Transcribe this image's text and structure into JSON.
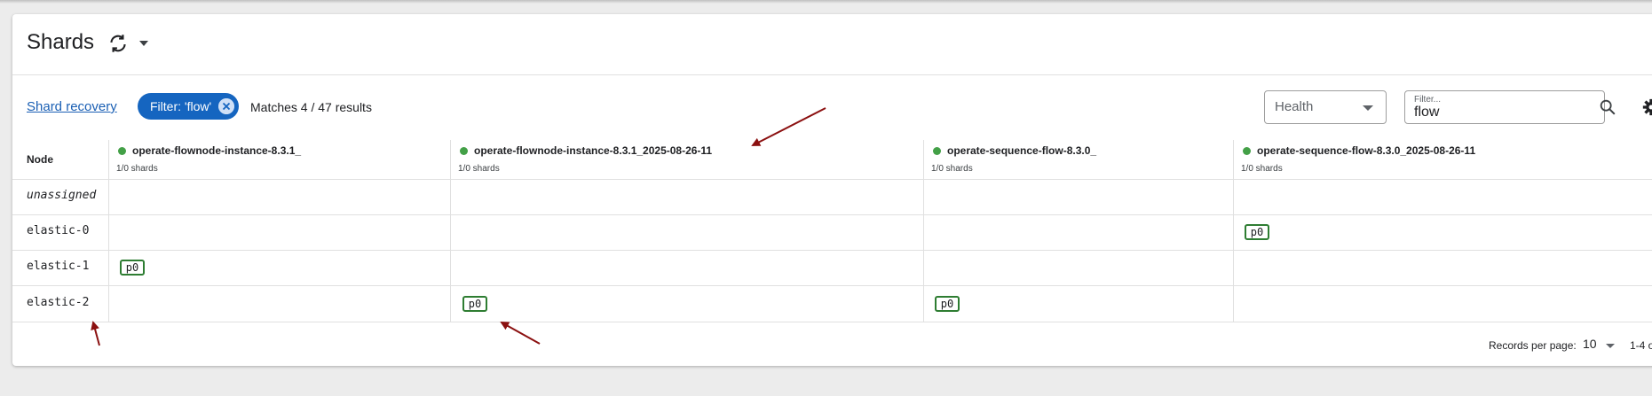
{
  "header": {
    "title": "Shards"
  },
  "toolbar": {
    "recovery_link": "Shard recovery",
    "filter_chip": "Filter: 'flow'",
    "matches": "Matches 4 / 47 results",
    "health_label": "Health",
    "filter_label": "Filter...",
    "filter_value": "flow"
  },
  "table": {
    "node_header": "Node",
    "indices": [
      {
        "name": "operate-flownode-instance-8.3.1_",
        "shards": "1/0 shards",
        "status": "green"
      },
      {
        "name": "operate-flownode-instance-8.3.1_2025-08-26-11",
        "shards": "1/0 shards",
        "status": "green"
      },
      {
        "name": "operate-sequence-flow-8.3.0_",
        "shards": "1/0 shards",
        "status": "green"
      },
      {
        "name": "operate-sequence-flow-8.3.0_2025-08-26-11",
        "shards": "1/0 shards",
        "status": "green"
      }
    ],
    "rows": [
      {
        "node": "unassigned",
        "cells": [
          "",
          "",
          "",
          ""
        ]
      },
      {
        "node": "elastic-0",
        "cells": [
          "",
          "",
          "",
          "p0"
        ]
      },
      {
        "node": "elastic-1",
        "cells": [
          "p0",
          "",
          "",
          ""
        ]
      },
      {
        "node": "elastic-2",
        "cells": [
          "",
          "p0",
          "p0",
          ""
        ]
      }
    ]
  },
  "pagination": {
    "records_label": "Records per page:",
    "records_value": "10",
    "range": "1-4 o"
  },
  "colors": {
    "accent": "#1565c0",
    "shard_border": "#2e7d32",
    "health_green": "#43a047",
    "annotation_arrow": "#8b1010"
  }
}
